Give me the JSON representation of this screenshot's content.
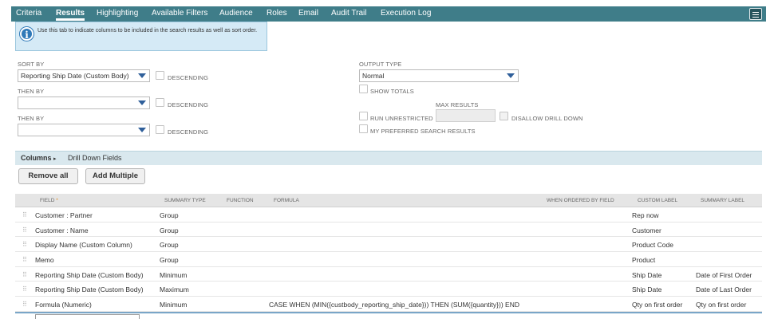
{
  "tabs": [
    "Criteria",
    "Results",
    "Highlighting",
    "Available Filters",
    "Audience",
    "Roles",
    "Email",
    "Audit Trail",
    "Execution Log"
  ],
  "active_tab": "Results",
  "info": "Use this tab to indicate columns to be included in the search results as well as sort order.",
  "sort": {
    "sort_by_label": "SORT BY",
    "sort_by_value": "Reporting Ship Date (Custom Body)",
    "then_by_label": "THEN BY",
    "descending_label": "DESCENDING"
  },
  "output": {
    "output_type_label": "OUTPUT TYPE",
    "output_type_value": "Normal",
    "show_totals_label": "SHOW TOTALS",
    "max_results_label": "MAX RESULTS",
    "run_unrestricted_label": "RUN UNRESTRICTED",
    "disallow_drill_down_label": "DISALLOW DRILL DOWN",
    "my_preferred_label": "MY PREFERRED SEARCH RESULTS"
  },
  "subtabs": [
    "Columns",
    "Drill Down Fields"
  ],
  "buttons": {
    "remove_all": "Remove all",
    "add_multiple": "Add Multiple"
  },
  "columns_table": {
    "headers": {
      "field": "FIELD",
      "summary_type": "SUMMARY TYPE",
      "function": "FUNCTION",
      "formula": "FORMULA",
      "when_ordered_by_field": "WHEN ORDERED BY FIELD",
      "custom_label": "CUSTOM LABEL",
      "summary_label": "SUMMARY LABEL"
    },
    "rows": [
      {
        "field": "Customer : Partner",
        "summary_type": "Group",
        "function": "",
        "formula": "",
        "when_ordered": "",
        "custom_label": "Rep now",
        "summary_label": ""
      },
      {
        "field": "Customer : Name",
        "summary_type": "Group",
        "function": "",
        "formula": "",
        "when_ordered": "",
        "custom_label": "Customer",
        "summary_label": ""
      },
      {
        "field": "Display Name (Custom Column)",
        "summary_type": "Group",
        "function": "",
        "formula": "",
        "when_ordered": "",
        "custom_label": "Product Code",
        "summary_label": ""
      },
      {
        "field": "Memo",
        "summary_type": "Group",
        "function": "",
        "formula": "",
        "when_ordered": "",
        "custom_label": "Product",
        "summary_label": ""
      },
      {
        "field": "Reporting Ship Date (Custom Body)",
        "summary_type": "Minimum",
        "function": "",
        "formula": "",
        "when_ordered": "",
        "custom_label": "Ship Date",
        "summary_label": "Date of First Order"
      },
      {
        "field": "Reporting Ship Date (Custom Body)",
        "summary_type": "Maximum",
        "function": "",
        "formula": "",
        "when_ordered": "",
        "custom_label": "Ship Date",
        "summary_label": "Date of Last Order"
      },
      {
        "field": "Formula (Numeric)",
        "summary_type": "Minimum",
        "function": "",
        "formula": "CASE WHEN (MIN({custbody_reporting_ship_date})) THEN (SUM({quantity})) END",
        "when_ordered": "",
        "custom_label": "Qty on first order",
        "summary_label": "Qty on first order"
      }
    ]
  },
  "colors": {
    "tab_bar": "#3f7d89",
    "info_bg": "#d5eaf6",
    "subtab_bg": "#d9e8ee",
    "header_bg": "#e5e5e5"
  }
}
